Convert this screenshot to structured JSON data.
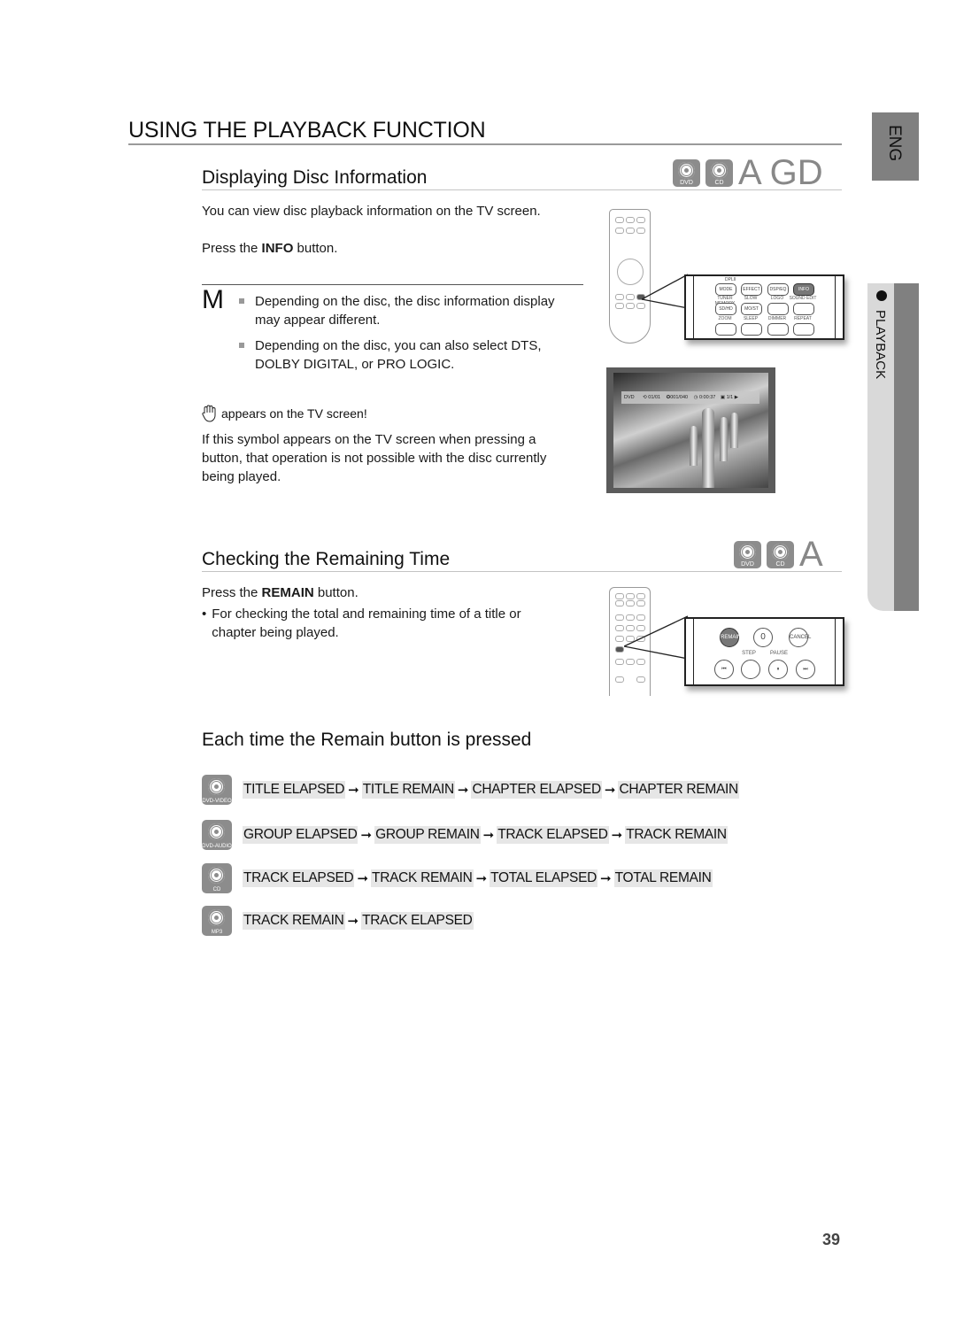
{
  "page": {
    "title": "USING THE PLAYBACK FUNCTION",
    "page_number": "39",
    "side_tabs": {
      "language": "ENG",
      "chapter": "PLAYBACK"
    }
  },
  "section_disc_info": {
    "title": "Displaying Disc Information",
    "badges": [
      {
        "icon": "dvd-disc-icon",
        "label": "DVD"
      },
      {
        "icon": "cd-disc-icon",
        "label": "CD"
      }
    ],
    "badge_letters": "A GD",
    "intro": "You can view disc playback information  on the TV screen.",
    "press_prefix": "Press the ",
    "press_button": "INFO",
    "press_suffix": " button.",
    "note_marker": "M",
    "notes": [
      "Depending on the disc, the disc information display may appear different.",
      "Depending on the disc, you can also select DTS, DOLBY DIGITAL, or PRO LOGIC."
    ],
    "warning_title": "appears on the TV screen!",
    "warning_text": "If this symbol appears on the TV screen when pressing a button, that operation is not possible with the disc currently being played.",
    "remote_callout": {
      "header": "DPLII",
      "row1": [
        "MODE",
        "EFFECT",
        "DSP/EQ",
        "INFO"
      ],
      "labels2": [
        "TUNER MEMORY",
        "SLOW",
        "LOGO",
        "SOUND EDIT"
      ],
      "row2": [
        "SD/HD",
        "MO/ST",
        "",
        ""
      ],
      "labels3": [
        "ZOOM",
        "SLEEP",
        "DIMMER",
        "REPEAT"
      ],
      "highlighted": "INFO"
    },
    "tv_osd": {
      "disc": "DVD",
      "title": "01/01",
      "chapter": "001/040",
      "time": "0:00:37",
      "angle": "1/1",
      "play_icon": "play-icon"
    }
  },
  "section_remaining": {
    "title": "Checking the Remaining Time",
    "badges": [
      {
        "icon": "dvd-disc-icon",
        "label": "DVD"
      },
      {
        "icon": "cd-disc-icon",
        "label": "CD"
      }
    ],
    "badge_letters": "A",
    "press_prefix": "Press the ",
    "press_button": "REMAIN",
    "press_suffix": " button.",
    "bullet": "For checking the total and remaining time of a title or chapter being played.",
    "remote_callout": {
      "row1": [
        "REMAIN",
        "0",
        "CANCEL"
      ],
      "labels": [
        "STEP",
        "PAUSE"
      ],
      "row2": [
        "⏮",
        "",
        "⏸",
        "⏭"
      ],
      "highlighted": "REMAIN"
    }
  },
  "section_sequence": {
    "title": "Each time the Remain button is pressed",
    "rows": [
      {
        "disc": "DVD-VIDEO",
        "steps": [
          "TITLE ELAPSED",
          "TITLE REMAIN",
          "CHAPTER ELAPSED",
          "CHAPTER REMAIN"
        ]
      },
      {
        "disc": "DVD-AUDIO",
        "steps": [
          "GROUP ELAPSED",
          "GROUP REMAIN",
          "TRACK ELAPSED",
          "TRACK REMAIN"
        ]
      },
      {
        "disc": "CD",
        "steps": [
          "TRACK ELAPSED",
          "TRACK REMAIN",
          "TOTAL ELAPSED",
          "TOTAL REMAIN"
        ]
      },
      {
        "disc": "MP3",
        "steps": [
          "TRACK REMAIN",
          "TRACK ELAPSED"
        ]
      }
    ],
    "arrow": "➞"
  }
}
